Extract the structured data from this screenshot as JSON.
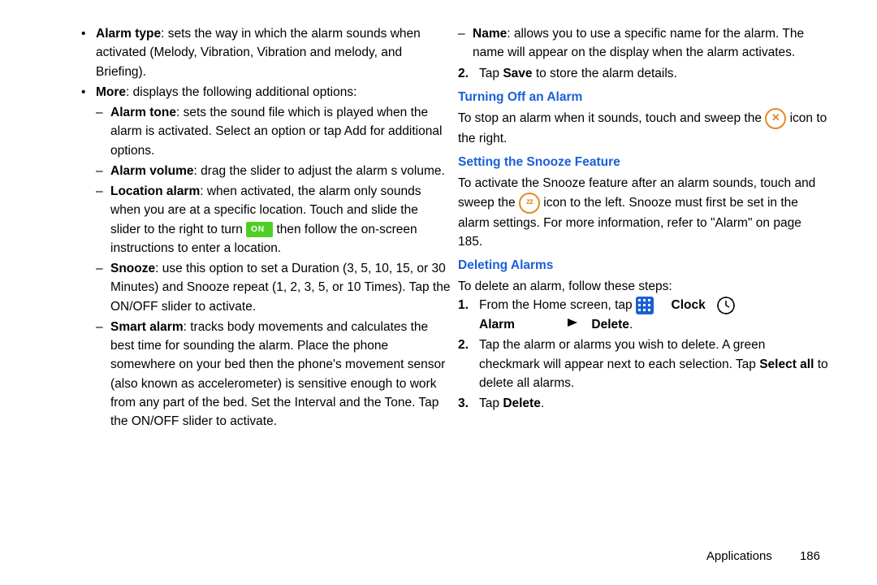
{
  "left": {
    "alarm_type_label": "Alarm type",
    "alarm_type_text": ": sets the way in which the alarm sounds when activated (Melody, Vibration, Vibration and melody, and Briefing).",
    "more_label": "More",
    "more_text": ": displays the following additional options:",
    "alarm_tone_label": "Alarm tone",
    "alarm_tone_text": ": sets the sound file which is played when the alarm is activated. Select an option or tap Add for additional options.",
    "alarm_volume_label": "Alarm volume",
    "alarm_volume_text": ": drag the slider to adjust the alarm s volume.",
    "location_label": "Location alarm",
    "location_text_a": ": when activated, the alarm only sounds when you are at a specific location. Touch and slide the slider to the right to turn ",
    "location_on": "ON",
    "location_text_b": " then follow the on-screen instructions to enter a location.",
    "snooze_label": "Snooze",
    "snooze_text": ": use this option to set a Duration (3, 5, 10, 15, or 30 Minutes) and Snooze repeat (1, 2, 3, 5, or 10 Times). Tap the ON/OFF slider to activate.",
    "smart_label": "Smart alarm",
    "smart_text": ": tracks body movements and calculates the best time for sounding the alarm. Place the phone somewhere on your bed then the phone's movement sensor (also known as accelerometer) is sensitive enough to work from any part of the bed. Set the Interval and the Tone. Tap the ON/OFF slider to activate."
  },
  "right": {
    "name_label": "Name",
    "name_text": ": allows you to use a specific name for the alarm. The name will appear on the display when the alarm activates.",
    "step2_a": "Tap ",
    "step2_b": "Save",
    "step2_c": " to store the alarm details.",
    "h_off": "Turning Off an Alarm",
    "off_text_a": "To stop an alarm when it sounds, touch and sweep the ",
    "off_text_b": " icon to the right.",
    "h_snooze": "Setting the Snooze Feature",
    "snooze_set_a": "To activate the Snooze feature after an alarm sounds, touch and sweep the ",
    "snooze_set_b": " icon to the left. Snooze must first be set in the alarm settings. For more information, refer to ",
    "snooze_ref_q1": "\"",
    "snooze_ref": "Alarm",
    "snooze_ref_q2": "\"",
    "snooze_ref_page": " on page 185.",
    "h_delete": "Deleting Alarms",
    "del_intro": "To delete an alarm, follow these steps:",
    "del1_a": "From the Home screen, tap ",
    "del1_clock": "Clock",
    "del1_alarm": "Alarm",
    "del1_delete": "Delete",
    "del1_dot": ".",
    "del2_a": "Tap the alarm or alarms you wish to delete. A green checkmark will appear next to each selection. Tap ",
    "del2_b": "Select all",
    "del2_c": " to delete all alarms.",
    "del3_a": "Tap ",
    "del3_b": "Delete",
    "del3_c": "."
  },
  "footer": {
    "section": "Applications",
    "page": "186"
  }
}
